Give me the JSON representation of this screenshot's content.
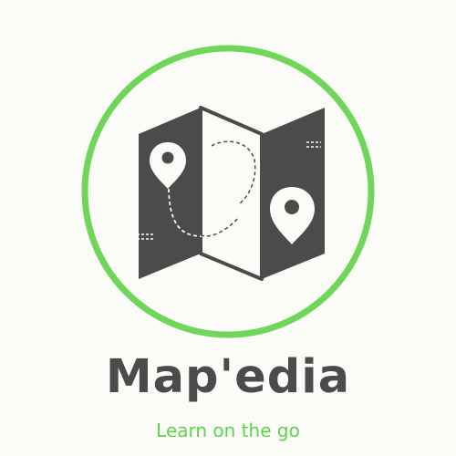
{
  "brand": {
    "name": "Map'edia",
    "tagline": "Learn on the go"
  },
  "icons": {
    "logo": "folded-map-with-location-pins-icon"
  },
  "colors": {
    "background": "#fbfbf8",
    "ring": "#6fd65a",
    "map": "#4b4b4b",
    "map_light": "#fbfbf8",
    "tagline": "#5fd24e",
    "brand_text": "#4b4b4b"
  }
}
